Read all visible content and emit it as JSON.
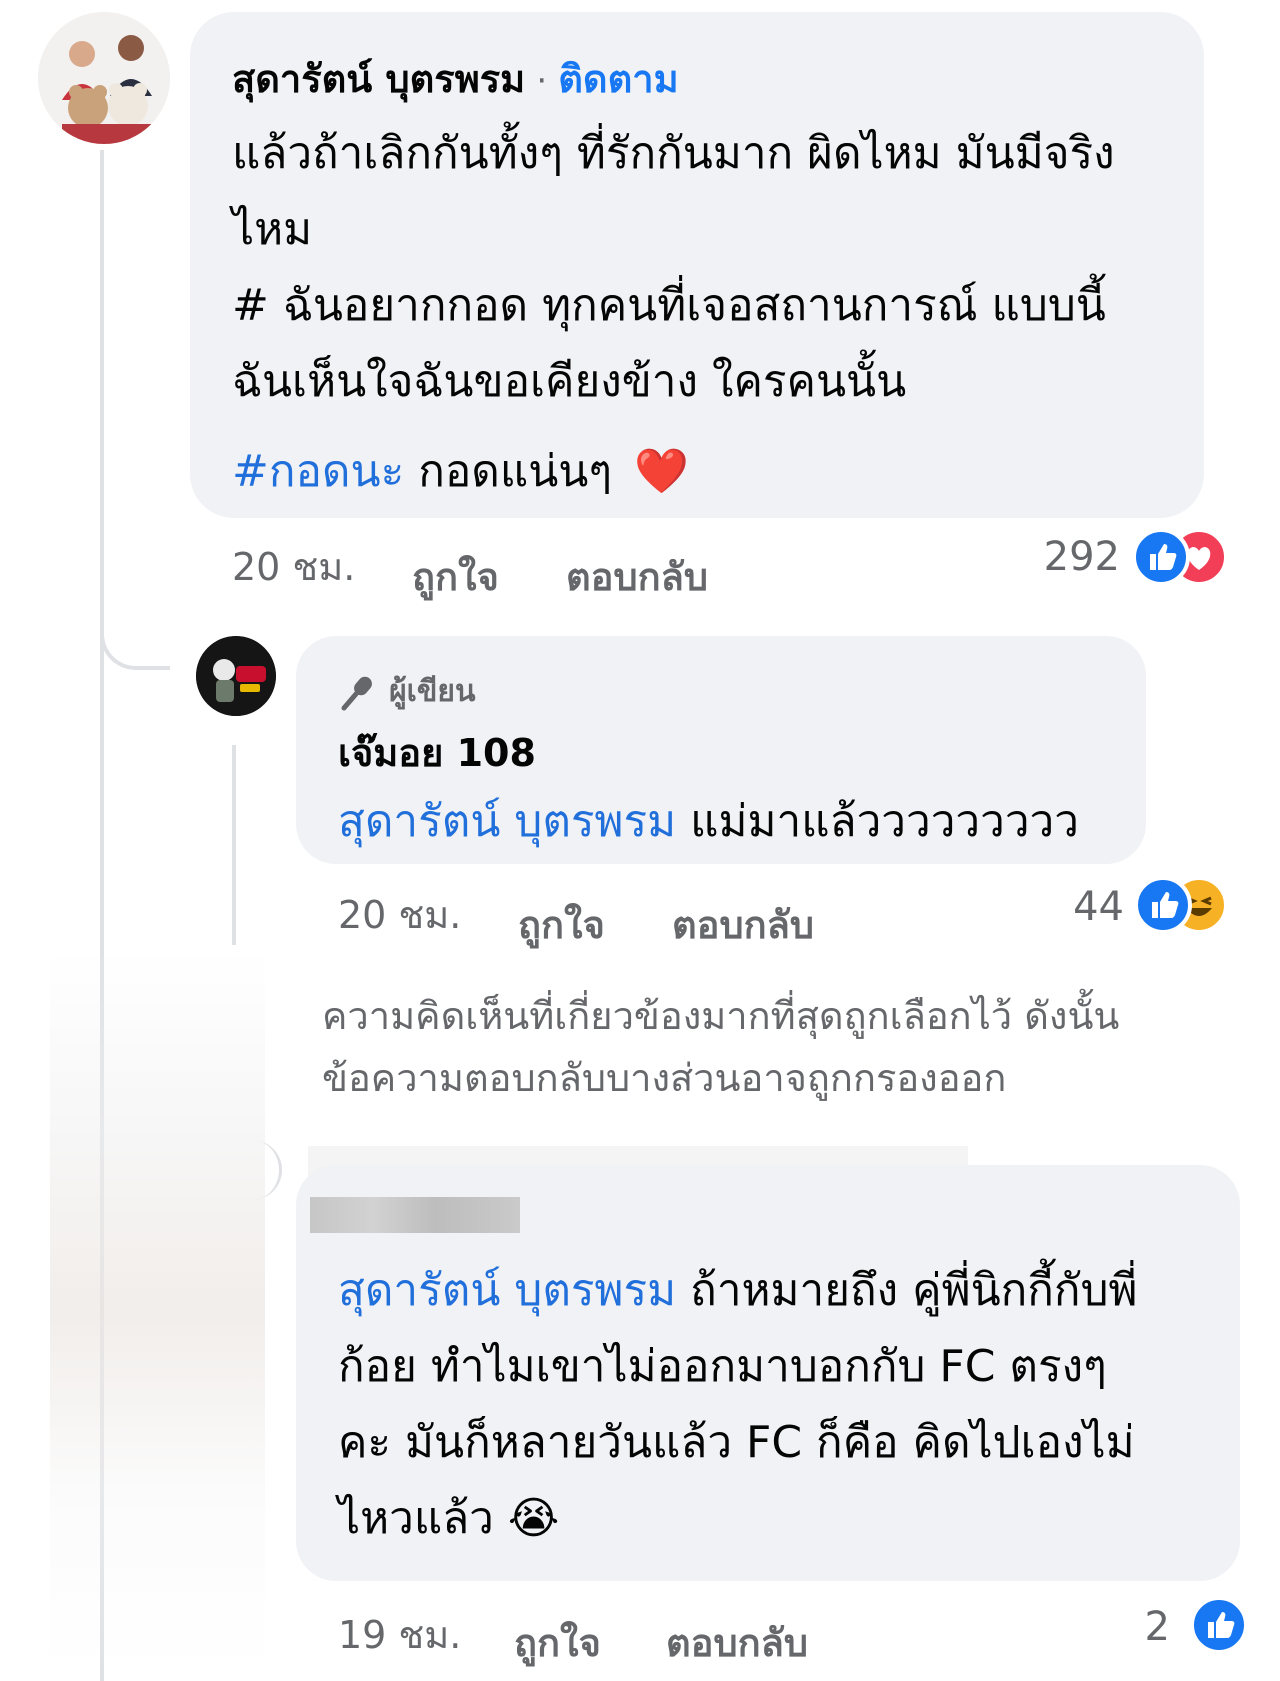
{
  "colors": {
    "accent": "#1877f2",
    "like": "#1877f2",
    "love": "#f33e58",
    "haha": "#f7b125",
    "bubble": "#f0f2f5",
    "muted": "#65676b"
  },
  "comment1": {
    "author": "สุดารัตน์ บุตรพรม",
    "separator": "·",
    "follow_label": "ติดตาม",
    "lines": [
      "แล้วถ้าเลิกกันทั้งๆ ที่รักกันมาก ผิดไหม มันมีจริง",
      "ไหม",
      "# ฉันอยากกอด ทุกคนที่เจอสถานการณ์ แบบนี้",
      "ฉันเห็นใจฉันขอเคียงข้าง ใครคนนั้น"
    ],
    "hashtag": "#กอดนะ",
    "tail": " กอดแน่นๆ",
    "emoji": "❤️",
    "time": "20 ชม.",
    "like_label": "ถูกใจ",
    "reply_label": "ตอบกลับ",
    "reaction_count": "292",
    "reactions": [
      "like-icon",
      "love-icon"
    ]
  },
  "reply1": {
    "badge": "ผู้เขียน",
    "author": "เจ๊มอย 108",
    "mention": "สุดารัตน์ บุตรพรม",
    "text": " แม่มาแล้ววววววววว",
    "time": "20 ชม.",
    "like_label": "ถูกใจ",
    "reply_label": "ตอบกลับ",
    "reaction_count": "44",
    "reactions": [
      "like-icon",
      "haha-icon"
    ]
  },
  "filter_notice": {
    "lines": [
      "ความคิดเห็นที่เกี่ยวข้องมากที่สุดถูกเลือกไว้ ดังนั้น",
      "ข้อความตอบกลับบางส่วนอาจถูกกรองออก"
    ]
  },
  "reply2": {
    "mention": "สุดารัตน์ บุตรพรม",
    "line1_rest": " ถ้าหมายถึง คู่พี่นิกกี้กับพี่",
    "lines": [
      "ก้อย ทำไมเขาไม่ออกมาบอกกับ FC ตรงๆ",
      "คะ  มันก็หลายวันแล้ว FC ก็คือ คิดไปเองไม่"
    ],
    "last_line": "ไหวแล้ว",
    "emoji": "😭",
    "time": "19 ชม.",
    "like_label": "ถูกใจ",
    "reply_label": "ตอบกลับ",
    "reaction_count": "2",
    "reactions": [
      "like-icon"
    ]
  }
}
